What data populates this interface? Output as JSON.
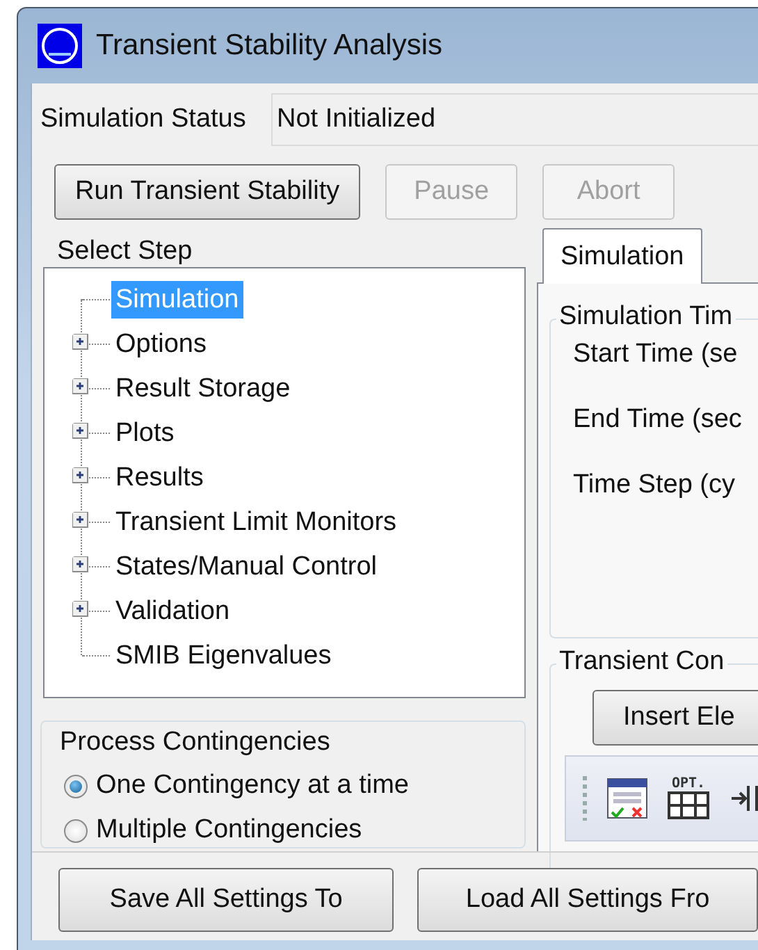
{
  "window": {
    "title": "Transient Stability Analysis"
  },
  "status": {
    "label": "Simulation Status",
    "value": "Not Initialized"
  },
  "actions": [
    {
      "label": "Run Transient Stability",
      "disabled": false
    },
    {
      "label": "Pause",
      "disabled": true
    },
    {
      "label": "Abort",
      "disabled": true
    }
  ],
  "select_step": {
    "title": "Select Step",
    "items": [
      {
        "label": "Simulation",
        "kind": "leaf",
        "selected": true
      },
      {
        "label": "Options",
        "kind": "group",
        "expanded": false,
        "selected": false
      },
      {
        "label": "Result Storage",
        "kind": "group",
        "expanded": false,
        "selected": false
      },
      {
        "label": "Plots",
        "kind": "group",
        "expanded": false,
        "selected": false
      },
      {
        "label": "Results",
        "kind": "group",
        "expanded": false,
        "selected": false
      },
      {
        "label": "Transient Limit Monitors",
        "kind": "group",
        "expanded": false,
        "selected": false
      },
      {
        "label": "States/Manual Control",
        "kind": "group",
        "expanded": false,
        "selected": false
      },
      {
        "label": "Validation",
        "kind": "group",
        "expanded": false,
        "selected": false
      },
      {
        "label": "SMIB Eigenvalues",
        "kind": "leaf",
        "selected": false
      }
    ]
  },
  "process_contingencies": {
    "title": "Process Contingencies",
    "options": [
      {
        "label": "One Contingency at a time",
        "selected": true
      },
      {
        "label": "Multiple Contingencies",
        "selected": false
      }
    ]
  },
  "tabs": [
    {
      "label": "Simulation",
      "selected": true
    }
  ],
  "simulation_time": {
    "title": "Simulation Tim",
    "fields": [
      "Start Time (se",
      "End Time (sec",
      "Time Step (cy"
    ]
  },
  "transient_contingencies": {
    "title": "Transient Con",
    "button": "Insert Ele",
    "toolbar": [
      {
        "kind": "grid-check"
      },
      {
        "kind": "opt-grid",
        "label": "OPT."
      },
      {
        "kind": "arrow-bar"
      }
    ]
  },
  "footer_buttons": [
    "Save All Settings To",
    "Load All Settings Fro"
  ]
}
